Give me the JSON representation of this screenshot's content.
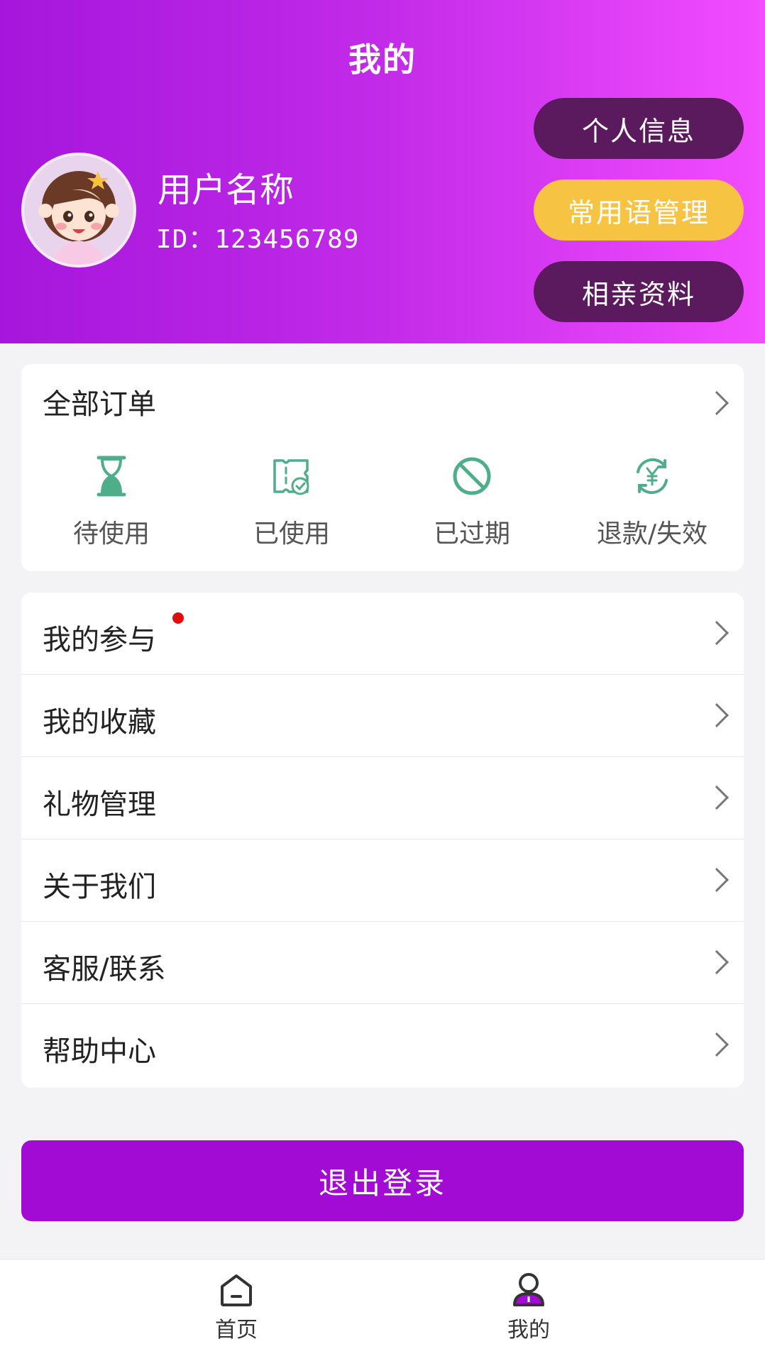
{
  "header": {
    "title": "我的",
    "username": "用户名称",
    "user_id": "ID：123456789",
    "buttons": [
      {
        "label": "个人信息",
        "color": "#5c1a5e"
      },
      {
        "label": "常用语管理",
        "color": "#f7c342"
      },
      {
        "label": "相亲资料",
        "color": "#5c1a5e"
      }
    ],
    "gradient": [
      "#a516dc",
      "#f24cff"
    ]
  },
  "orders": {
    "title": "全部订单",
    "items": [
      {
        "label": "待使用",
        "icon": "hourglass-icon"
      },
      {
        "label": "已使用",
        "icon": "ticket-check-icon"
      },
      {
        "label": "已过期",
        "icon": "prohibited-icon"
      },
      {
        "label": "退款/失效",
        "icon": "refund-yen-icon"
      }
    ],
    "icon_color": "#4fae8a"
  },
  "menu": {
    "items": [
      {
        "label": "我的参与",
        "badge": true
      },
      {
        "label": "我的收藏"
      },
      {
        "label": "礼物管理"
      },
      {
        "label": "关于我们"
      },
      {
        "label": "客服/联系"
      },
      {
        "label": "帮助中心"
      }
    ]
  },
  "logout_label": "退出登录",
  "nav": {
    "items": [
      {
        "label": "首页",
        "icon": "home-icon",
        "active": false
      },
      {
        "label": "我的",
        "icon": "profile-icon",
        "active": true
      }
    ],
    "accent": "#a10bd3"
  }
}
